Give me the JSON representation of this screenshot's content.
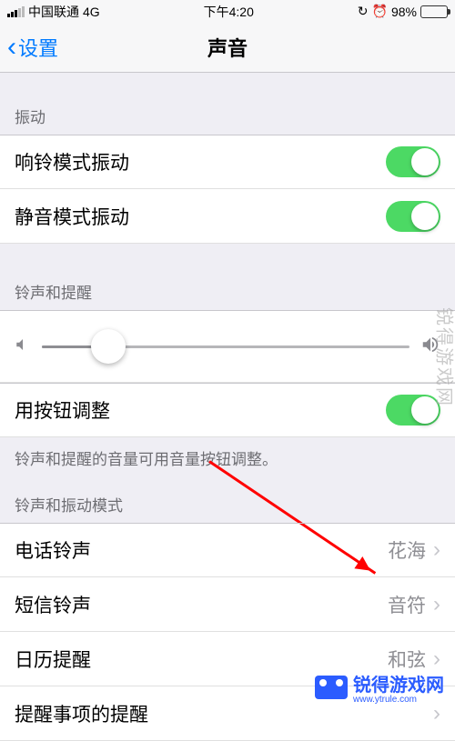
{
  "status": {
    "carrier": "中国联通",
    "network": "4G",
    "time": "下午4:20",
    "battery_pct": "98%"
  },
  "nav": {
    "back": "设置",
    "title": "声音"
  },
  "sections": {
    "vibration": {
      "header": "振动",
      "ring_vib": "响铃模式振动",
      "silent_vib": "静音模式振动"
    },
    "ringer": {
      "header": "铃声和提醒",
      "button_toggle": "用按钮调整",
      "footer": "铃声和提醒的音量可用音量按钮调整。"
    },
    "patterns": {
      "header": "铃声和振动模式",
      "ringtone_label": "电话铃声",
      "ringtone_value": "花海",
      "text_label": "短信铃声",
      "text_value": "音符",
      "calendar_label": "日历提醒",
      "calendar_value": "和弦",
      "reminder_label": "提醒事项的提醒"
    }
  },
  "watermark": "锐得游戏网",
  "logo_text": "锐得游戏网",
  "logo_sub": "www.ytrule.com"
}
